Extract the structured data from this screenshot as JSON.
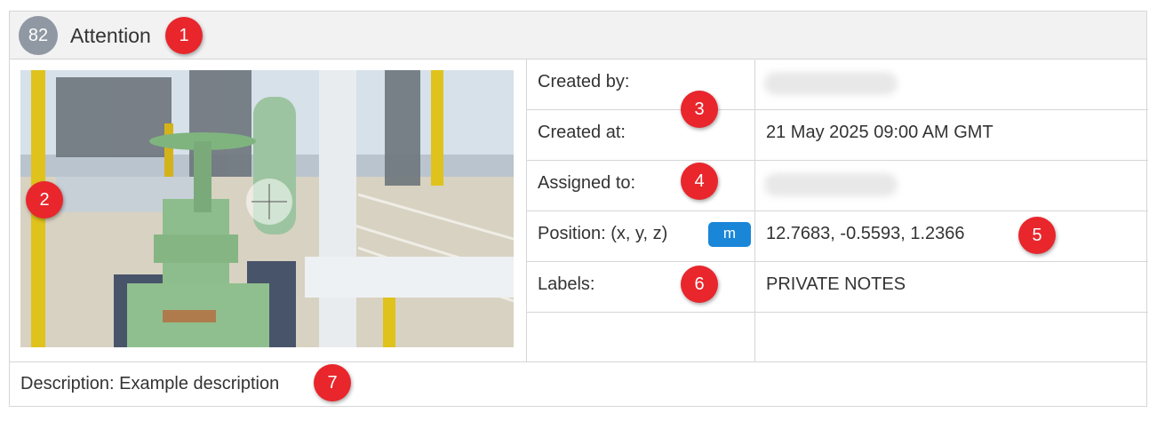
{
  "header": {
    "id": "82",
    "title": "Attention"
  },
  "fields": [
    {
      "label": "Created by:",
      "value": ""
    },
    {
      "label": "Created at:",
      "value": "21 May 2025 09:00 AM GMT"
    },
    {
      "label": "Assigned to:",
      "value": ""
    },
    {
      "label": "Position: (x, y, z)",
      "value": "12.7683, -0.5593, 1.2366",
      "unit": "m"
    },
    {
      "label": "Labels:",
      "value": "PRIVATE NOTES"
    },
    {
      "label": "",
      "value": ""
    }
  ],
  "description": "Description: Example description",
  "markers": [
    "1",
    "2",
    "3",
    "4",
    "5",
    "6",
    "7"
  ],
  "colors": {
    "marker": "#e8262c",
    "unit_button": "#1a86d8",
    "id_badge": "#8f98a3"
  }
}
